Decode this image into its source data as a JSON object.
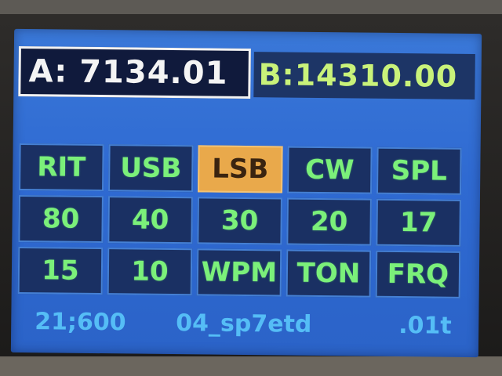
{
  "vfo": {
    "a_text": "A:  7134.01",
    "b_text": "B:14310.00"
  },
  "buttons": [
    {
      "label": "RIT",
      "active": false
    },
    {
      "label": "USB",
      "active": false
    },
    {
      "label": "LSB",
      "active": true
    },
    {
      "label": "CW",
      "active": false
    },
    {
      "label": "SPL",
      "active": false
    },
    {
      "label": "80",
      "active": false
    },
    {
      "label": "40",
      "active": false
    },
    {
      "label": "30",
      "active": false
    },
    {
      "label": "20",
      "active": false
    },
    {
      "label": "17",
      "active": false
    },
    {
      "label": "15",
      "active": false
    },
    {
      "label": "10",
      "active": false
    },
    {
      "label": "WPM",
      "active": false
    },
    {
      "label": "TON",
      "active": false
    },
    {
      "label": "FRQ",
      "active": false
    }
  ],
  "status": {
    "left": "21;600",
    "center": "04_sp7etd",
    "right": ".01t"
  },
  "colors": {
    "screen_bg": "#2f6ad2",
    "button_bg": "#1a3063",
    "button_text": "#7bf07a",
    "active_button_bg": "#e9a94b",
    "active_button_text": "#3a2410",
    "vfo_a_text": "#f4f4f4",
    "vfo_b_text": "#c9f27a",
    "status_text": "#55bdf6"
  }
}
